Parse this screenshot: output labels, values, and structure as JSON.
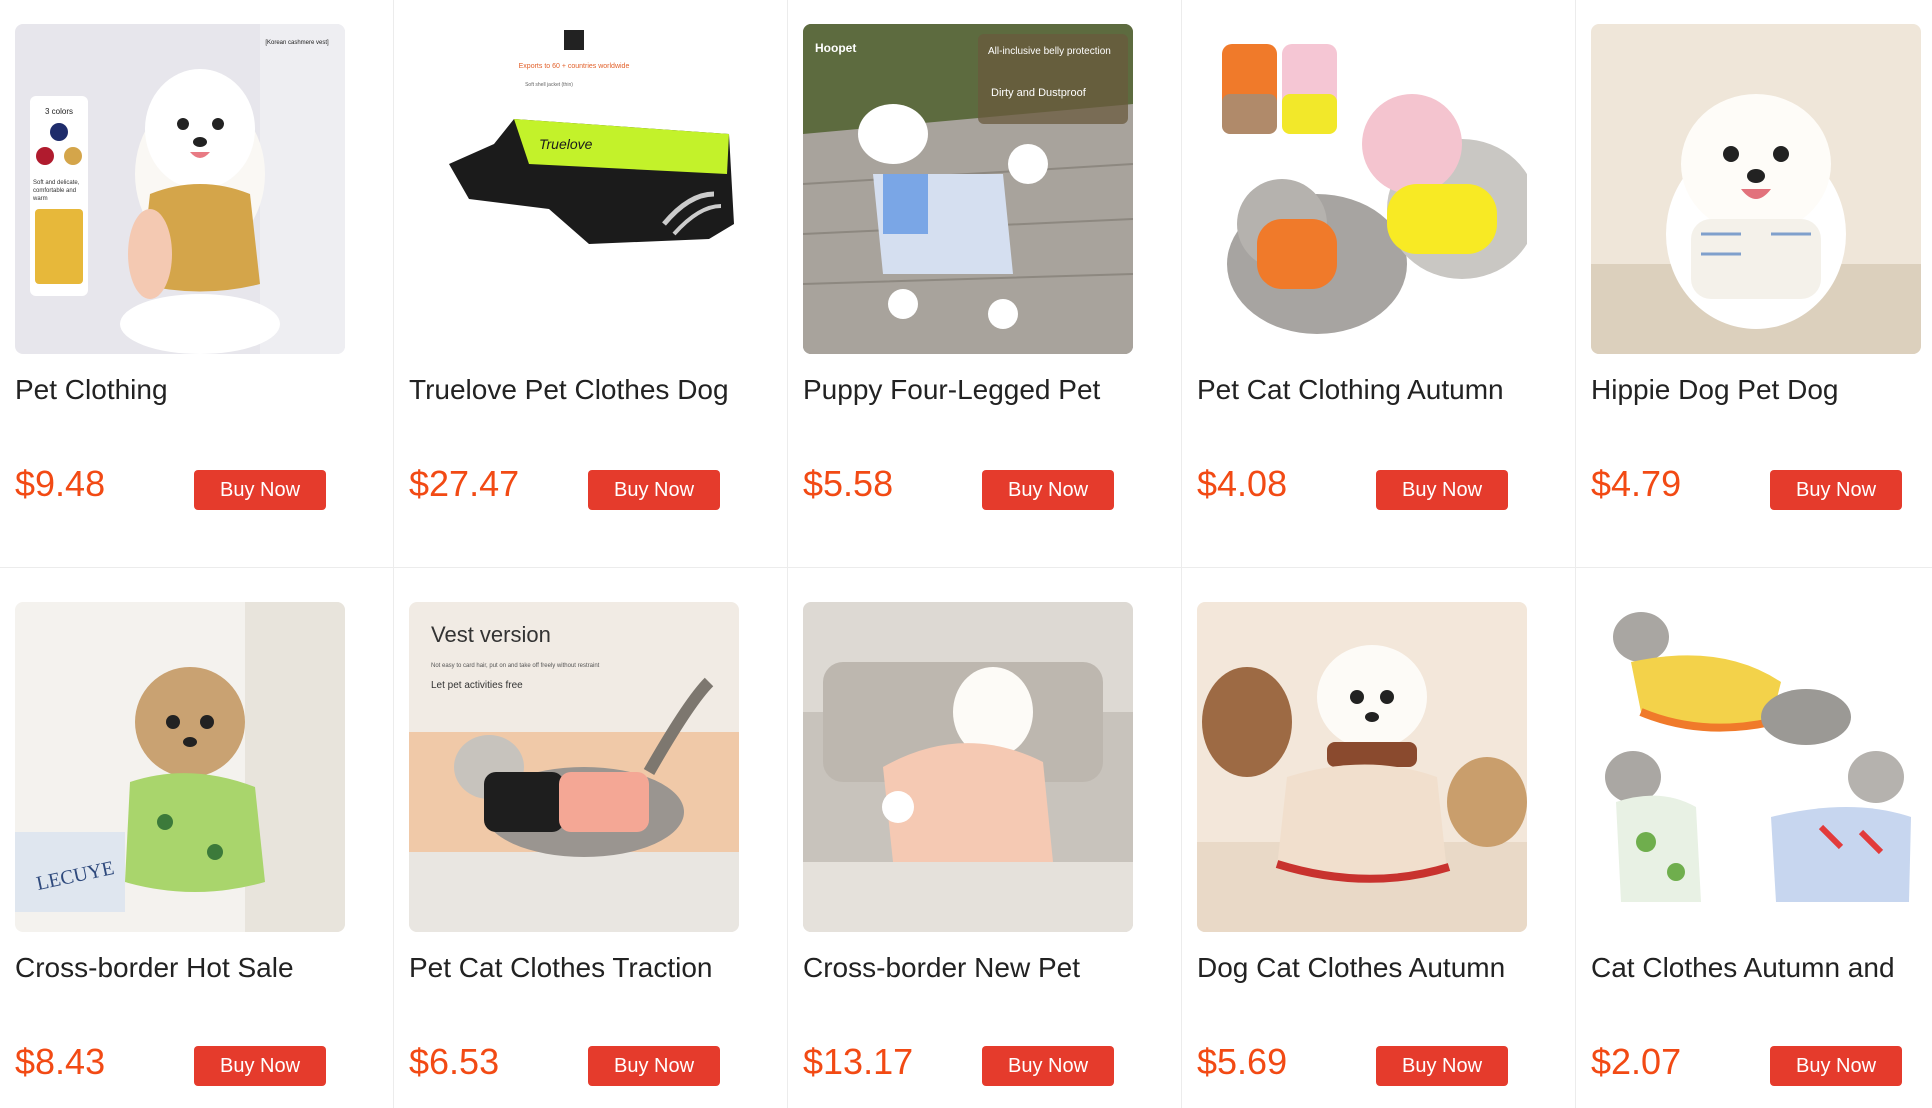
{
  "buy_label": "Buy Now",
  "products": [
    {
      "title": "Pet Clothing",
      "price": "$9.48",
      "image_text": [
        "[Korean cashmere vest]",
        "3 colors",
        "Soft and delicate, comfortable and warm"
      ]
    },
    {
      "title": "Truelove Pet Clothes Dog",
      "price": "$27.47",
      "image_text": [
        "Exports to 60 + countries worldwide",
        "Soft shell jacket (thin)",
        "Truelove"
      ]
    },
    {
      "title": "Puppy Four-Legged Pet",
      "price": "$5.58",
      "image_text": [
        "Hoopet",
        "All-inclusive belly protection",
        "Dirty and Dustproof"
      ]
    },
    {
      "title": "Pet Cat Clothing Autumn",
      "price": "$4.08",
      "image_text": []
    },
    {
      "title": "Hippie Dog Pet Dog",
      "price": "$4.79",
      "image_text": []
    },
    {
      "title": "Cross-border Hot Sale",
      "price": "$8.43",
      "image_text": [
        "LECUYE"
      ]
    },
    {
      "title": "Pet Cat Clothes Traction",
      "price": "$6.53",
      "image_text": [
        "Vest version",
        "Not easy to card hair, put on and take off freely without restraint",
        "Let pet activities free"
      ]
    },
    {
      "title": "Cross-border New Pet",
      "price": "$13.17",
      "image_text": []
    },
    {
      "title": "Dog Cat Clothes Autumn",
      "price": "$5.69",
      "image_text": []
    },
    {
      "title": "Cat Clothes Autumn and",
      "price": "$2.07",
      "image_text": []
    }
  ],
  "colors": {
    "price": "#f24a14",
    "button": "#e53b2c"
  }
}
